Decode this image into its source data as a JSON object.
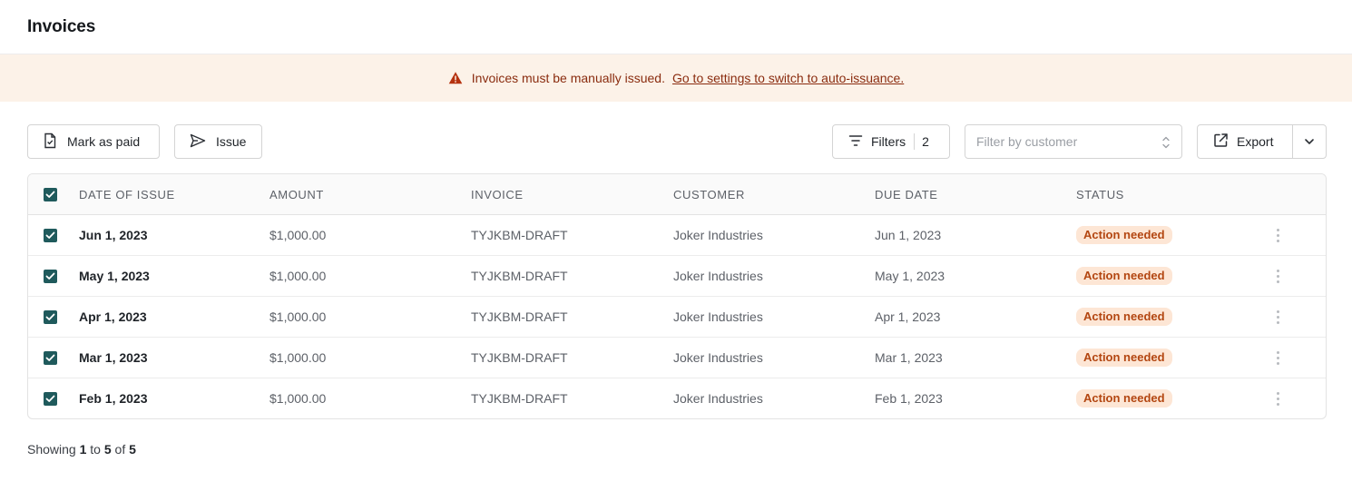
{
  "page": {
    "title": "Invoices"
  },
  "banner": {
    "message": "Invoices must be manually issued.",
    "link": "Go to settings to switch to auto-issuance.",
    "color": "#8a2c0f",
    "background": "#fcf2e8"
  },
  "toolbar": {
    "mark_as_paid": "Mark as paid",
    "issue": "Issue",
    "filters_label": "Filters",
    "filters_count": "2",
    "customer_placeholder": "Filter by customer",
    "export": "Export"
  },
  "table": {
    "columns": [
      "DATE OF ISSUE",
      "AMOUNT",
      "INVOICE",
      "CUSTOMER",
      "DUE DATE",
      "STATUS"
    ],
    "rows": [
      {
        "date": "Jun 1, 2023",
        "amount": "$1,000.00",
        "invoice": "TYJKBM-DRAFT",
        "customer": "Joker Industries",
        "due": "Jun 1, 2023",
        "status": "Action needed",
        "checked": true
      },
      {
        "date": "May 1, 2023",
        "amount": "$1,000.00",
        "invoice": "TYJKBM-DRAFT",
        "customer": "Joker Industries",
        "due": "May 1, 2023",
        "status": "Action needed",
        "checked": true
      },
      {
        "date": "Apr 1, 2023",
        "amount": "$1,000.00",
        "invoice": "TYJKBM-DRAFT",
        "customer": "Joker Industries",
        "due": "Apr 1, 2023",
        "status": "Action needed",
        "checked": true
      },
      {
        "date": "Mar 1, 2023",
        "amount": "$1,000.00",
        "invoice": "TYJKBM-DRAFT",
        "customer": "Joker Industries",
        "due": "Mar 1, 2023",
        "status": "Action needed",
        "checked": true
      },
      {
        "date": "Feb 1, 2023",
        "amount": "$1,000.00",
        "invoice": "TYJKBM-DRAFT",
        "customer": "Joker Industries",
        "due": "Feb 1, 2023",
        "status": "Action needed",
        "checked": true
      }
    ]
  },
  "pagination": {
    "prefix": "Showing",
    "from": "1",
    "to_word": "to",
    "to": "5",
    "of_word": "of",
    "total": "5"
  },
  "colors": {
    "checkbox": "#1f5a5c",
    "badge_bg": "#fde6d5",
    "badge_text": "#b34611"
  }
}
